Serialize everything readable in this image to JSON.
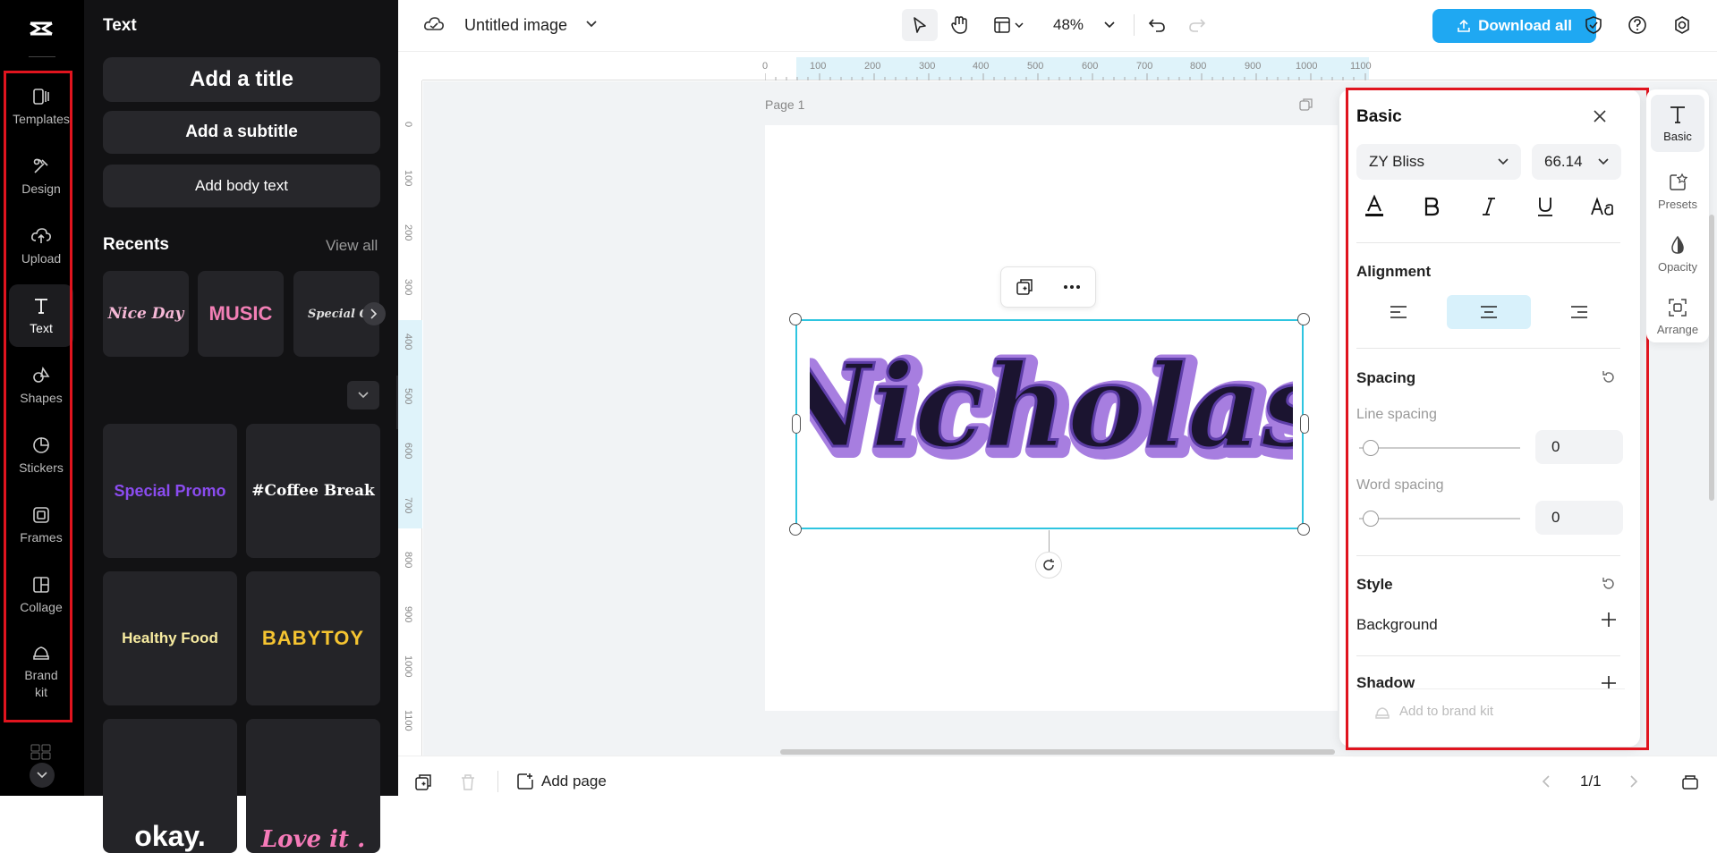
{
  "rail": {
    "items": [
      {
        "label": "Templates",
        "icon": "templates-icon"
      },
      {
        "label": "Design",
        "icon": "design-icon"
      },
      {
        "label": "Upload",
        "icon": "upload-icon"
      },
      {
        "label": "Text",
        "icon": "text-icon",
        "active": true
      },
      {
        "label": "Shapes",
        "icon": "shapes-icon"
      },
      {
        "label": "Stickers",
        "icon": "stickers-icon"
      },
      {
        "label": "Frames",
        "icon": "frames-icon"
      },
      {
        "label": "Collage",
        "icon": "collage-icon"
      },
      {
        "label": "Brand kit",
        "icon": "brand-kit-icon"
      }
    ]
  },
  "panel": {
    "title": "Text",
    "add_title": "Add a title",
    "add_subtitle": "Add a subtitle",
    "add_body": "Add body text",
    "recents_title": "Recents",
    "view_all": "View all",
    "recents": [
      "Nice Day",
      "MUSIC",
      "Special Offe"
    ],
    "templates": [
      "Special Promo",
      "#Coffee Break",
      "Healthy Food",
      "BABYTOY",
      "okay.",
      "Love it ."
    ]
  },
  "topbar": {
    "doc_title": "Untitled image",
    "zoom": "48%",
    "download": "Download all"
  },
  "ruler": {
    "top": [
      "0",
      "100",
      "200",
      "300",
      "400",
      "500",
      "600",
      "700",
      "800",
      "900",
      "1000",
      "1100"
    ],
    "left": [
      "0",
      "100",
      "200",
      "300",
      "400",
      "500",
      "600",
      "700",
      "800",
      "900",
      "1000",
      "1100"
    ]
  },
  "canvas": {
    "page_label": "Page 1",
    "text": "Nicholas"
  },
  "bottombar": {
    "add_page": "Add page",
    "pager": "1/1"
  },
  "props": {
    "title": "Basic",
    "font": "ZY Bliss",
    "size": "66.14",
    "alignment_title": "Alignment",
    "alignment_selected": "center",
    "spacing_title": "Spacing",
    "line_spacing_label": "Line spacing",
    "line_spacing": "0",
    "word_spacing_label": "Word spacing",
    "word_spacing": "0",
    "style_title": "Style",
    "background_label": "Background",
    "shadow_label": "Shadow",
    "brand_kit": "Add to brand kit"
  },
  "sidetabs": [
    "Basic",
    "Presets",
    "Opacity",
    "Arrange"
  ],
  "colors": {
    "accent": "#1fa8f2",
    "selection": "#2ec5e0",
    "highlight_red": "#e0141e",
    "text_fill": "#1b1430",
    "text_outline": "#a77ee0"
  }
}
